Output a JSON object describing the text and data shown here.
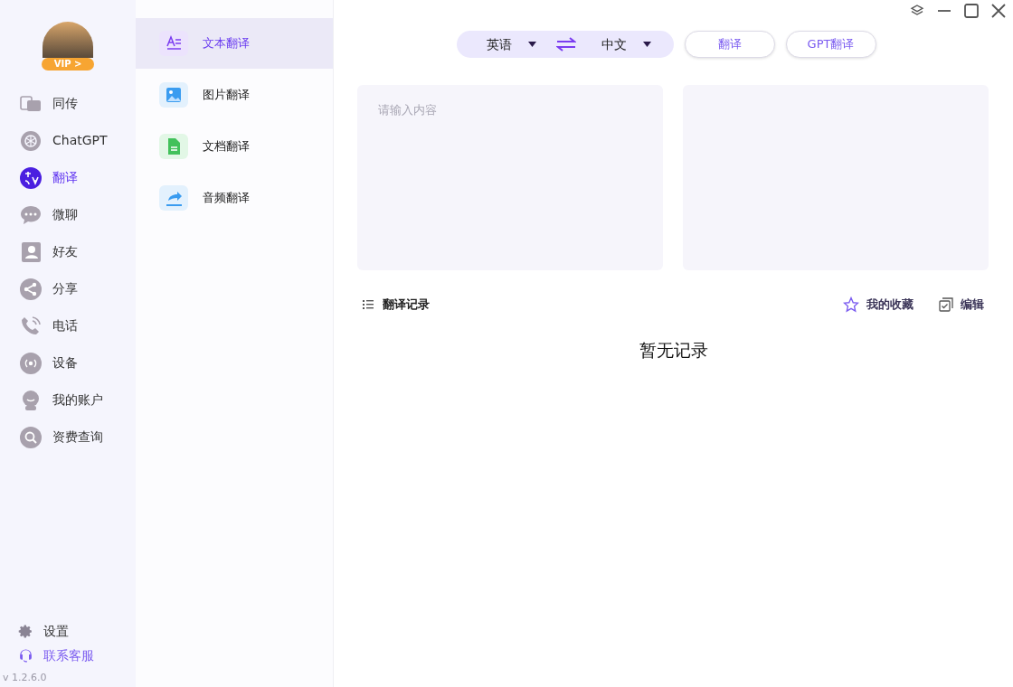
{
  "profile": {
    "badge": "VIP >"
  },
  "nav": [
    {
      "kind": "simul",
      "label": "同传",
      "selected": false
    },
    {
      "kind": "gpt",
      "label": "ChatGPT",
      "selected": false
    },
    {
      "kind": "translate",
      "label": "翻译",
      "selected": true
    },
    {
      "kind": "chat",
      "label": "微聊",
      "selected": false
    },
    {
      "kind": "contact",
      "label": "好友",
      "selected": false
    },
    {
      "kind": "share",
      "label": "分享",
      "selected": false
    },
    {
      "kind": "phone",
      "label": "电话",
      "selected": false
    },
    {
      "kind": "device",
      "label": "设备",
      "selected": false
    },
    {
      "kind": "account",
      "label": "我的账户",
      "selected": false
    },
    {
      "kind": "search",
      "label": "资费查询",
      "selected": false
    }
  ],
  "footer": {
    "settings": "设置",
    "support": "联系客服",
    "version": "v 1.2.6.0"
  },
  "submenu": [
    {
      "kind": "text",
      "label": "文本翻译",
      "selected": true
    },
    {
      "kind": "image",
      "label": "图片翻译",
      "selected": false
    },
    {
      "kind": "doc",
      "label": "文档翻译",
      "selected": false
    },
    {
      "kind": "audio",
      "label": "音频翻译",
      "selected": false
    }
  ],
  "toolbar": {
    "source_language": "英语",
    "target_language": "中文",
    "buttons": [
      "翻译",
      "GPT翻译"
    ]
  },
  "input": {
    "placeholder": "请输入内容"
  },
  "history": {
    "title": "翻译记录",
    "favorites": "我的收藏",
    "edit": "编辑",
    "empty": "暂无记录"
  }
}
